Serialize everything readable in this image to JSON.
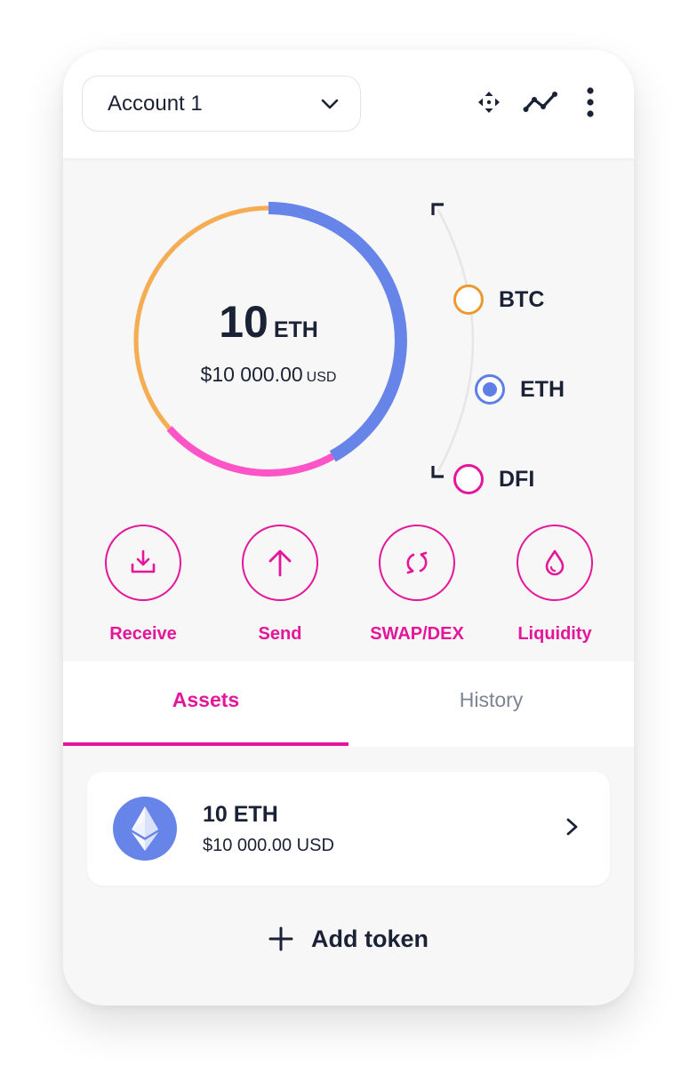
{
  "header": {
    "account_selector": {
      "label": "Account 1",
      "icon": "chevron-down-icon"
    },
    "icons": [
      "move-arrows-icon",
      "line-chart-icon",
      "more-vertical-icon"
    ]
  },
  "portfolio": {
    "balance": {
      "amount": "10",
      "unit": "ETH",
      "usd": "$10 000.00",
      "usd_currency": "USD"
    },
    "ring_colors": {
      "btc": "#f6ac50",
      "eth": "#6784e8",
      "dfi": "#fd54c7",
      "track": "#ececec"
    },
    "coins": [
      {
        "label": "BTC",
        "color": "#ec9a2e",
        "selected": false
      },
      {
        "label": "ETH",
        "color": "#5f7fe6",
        "selected": true
      },
      {
        "label": "DFI",
        "color": "#e4169a",
        "selected": false
      }
    ]
  },
  "actions": [
    {
      "label": "Receive",
      "icon": "receive-icon"
    },
    {
      "label": "Send",
      "icon": "send-arrow-icon"
    },
    {
      "label": "SWAP/DEX",
      "icon": "swap-icon"
    },
    {
      "label": "Liquidity",
      "icon": "liquidity-drop-icon"
    }
  ],
  "tabs": [
    {
      "label": "Assets",
      "active": true
    },
    {
      "label": "History",
      "active": false
    }
  ],
  "assets": [
    {
      "amount": "10 ETH",
      "usd": "$10 000.00 USD",
      "icon": "ethereum-icon"
    }
  ],
  "add_token": {
    "label": "Add token",
    "icon": "plus-icon"
  },
  "colors": {
    "accent": "#e4169a",
    "text_dark": "#1b2236",
    "text_muted": "#7d8591"
  }
}
